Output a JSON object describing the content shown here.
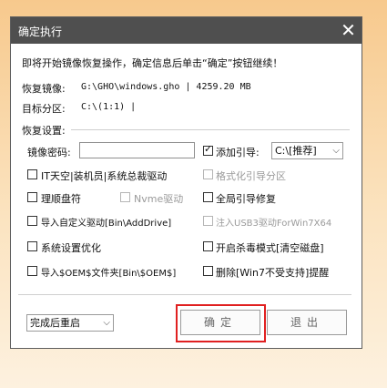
{
  "window": {
    "title": "确定执行",
    "close_symbol": "✕"
  },
  "intro_text": "即将开始镜像恢复操作，确定信息后单击“确定”按钮继续！",
  "image_label": "恢复镜像:",
  "image_value": "G:\\GHO\\windows.gho  |  4259.20 MB",
  "target_label": "目标分区:",
  "target_value": "C:\\(1:1)  |",
  "settings_title": "恢复设置:",
  "password_label": "镜像密码:",
  "password_value": "",
  "add_boot": {
    "label": "添加引导:",
    "checked": true,
    "select_value": "C:\\[推荐]"
  },
  "options": {
    "it_tiantong": "IT天空|装机员|系统总裁驱动",
    "format_boot": "格式化引导分区",
    "sort_drive": "理顺盘符",
    "nvme": "Nvme驱动",
    "global_boot_repair": "全局引导修复",
    "import_driver": "导入自定义驱动[Bin\\AddDrive]",
    "inject_usb3": "注入USB3驱动ForWin7X64",
    "sys_optimize": "系统设置优化",
    "antivirus_mode": "开启杀毒模式[清空磁盘]",
    "import_oem": "导入$OEM$文件夹[Bin\\$OEM$]",
    "remove_win7": "删除[Win7不受支持]提醒"
  },
  "after_action": {
    "selected": "完成后重启"
  },
  "buttons": {
    "ok": "确定",
    "cancel": "退出"
  },
  "colors": {
    "titlebar": "#4f4f4f",
    "highlight": "#e02020"
  }
}
